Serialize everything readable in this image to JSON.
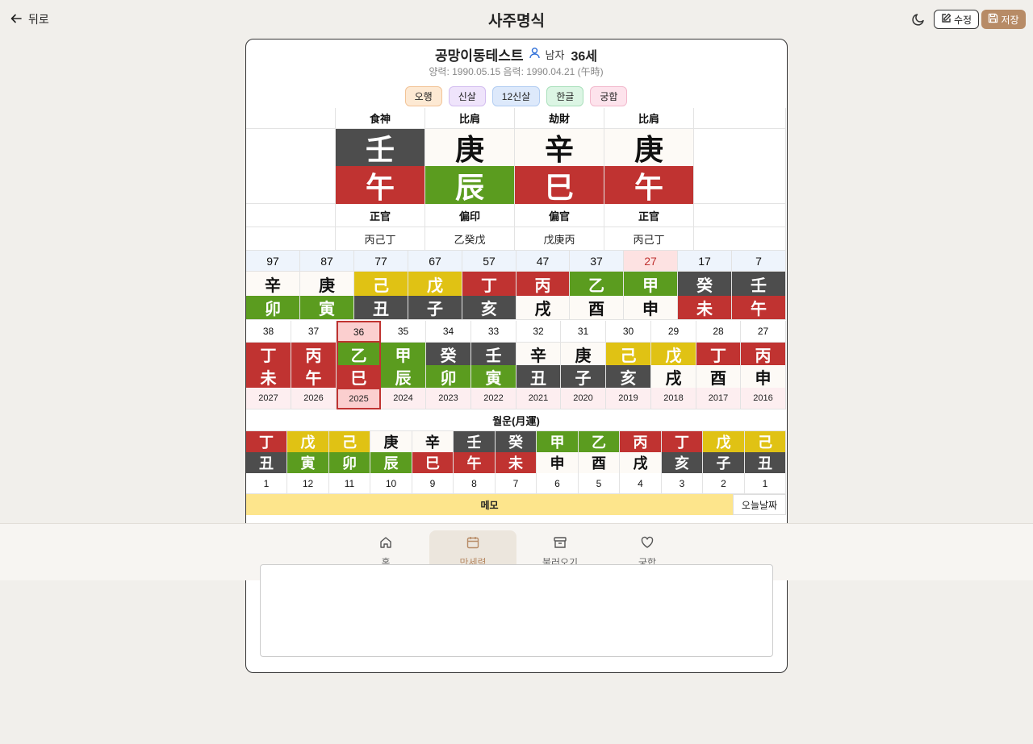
{
  "header": {
    "back_label": "뒤로",
    "title": "사주명식",
    "edit_label": "수정",
    "save_label": "저장"
  },
  "profile": {
    "name": "공망이동테스트",
    "gender": "남자",
    "age": "36세",
    "dates": "양력: 1990.05.15 음력: 1990.04.21 (午時)"
  },
  "chips": [
    {
      "label": "오행",
      "bg": "#fde9d3",
      "border": "#f2c396"
    },
    {
      "label": "신살",
      "bg": "#efe4fb",
      "border": "#d3bdf0"
    },
    {
      "label": "12신살",
      "bg": "#dde9fb",
      "border": "#b2cdf2"
    },
    {
      "label": "한글",
      "bg": "#dcf5e4",
      "border": "#a9e0bb"
    },
    {
      "label": "궁합",
      "bg": "#fde3ec",
      "border": "#f2b8cc"
    }
  ],
  "colors": {
    "fire": "#c03331",
    "wood": "#5b9c1f",
    "earth": "#e0c214",
    "water": "#4d4d4d",
    "metal": "#fdfaf6",
    "highlight": "#fbcfcf",
    "highlight_border": "#c03331",
    "memo": "#fde58c",
    "accent": "#b78b66"
  },
  "pillars": [
    {
      "top_god": "食神",
      "stem": "壬",
      "stem_el": "water",
      "branch": "午",
      "branch_el": "fire",
      "bot_god": "正官",
      "hidden": "丙己丁"
    },
    {
      "top_god": "比肩",
      "stem": "庚",
      "stem_el": "metal",
      "branch": "辰",
      "branch_el": "wood",
      "bot_god": "偏印",
      "hidden": "乙癸戊"
    },
    {
      "top_god": "劫財",
      "stem": "辛",
      "stem_el": "metal",
      "branch": "巳",
      "branch_el": "fire",
      "bot_god": "偏官",
      "hidden": "戊庚丙"
    },
    {
      "top_god": "比肩",
      "stem": "庚",
      "stem_el": "metal",
      "branch": "午",
      "branch_el": "fire",
      "bot_god": "正官",
      "hidden": "丙己丁"
    }
  ],
  "daewoon": [
    {
      "age": "97",
      "stem": "辛",
      "se": "metal",
      "branch": "卯",
      "be": "wood"
    },
    {
      "age": "87",
      "stem": "庚",
      "se": "metal",
      "branch": "寅",
      "be": "wood"
    },
    {
      "age": "77",
      "stem": "己",
      "se": "earth",
      "branch": "丑",
      "be": "water"
    },
    {
      "age": "67",
      "stem": "戊",
      "se": "earth",
      "branch": "子",
      "be": "water"
    },
    {
      "age": "57",
      "stem": "丁",
      "se": "fire",
      "branch": "亥",
      "be": "water"
    },
    {
      "age": "47",
      "stem": "丙",
      "se": "fire",
      "branch": "戌",
      "be": "metal"
    },
    {
      "age": "37",
      "stem": "乙",
      "se": "wood",
      "branch": "酉",
      "be": "metal"
    },
    {
      "age": "27",
      "stem": "甲",
      "se": "wood",
      "branch": "申",
      "be": "metal",
      "current": true
    },
    {
      "age": "17",
      "stem": "癸",
      "se": "water",
      "branch": "未",
      "be": "fire"
    },
    {
      "age": "7",
      "stem": "壬",
      "se": "water",
      "branch": "午",
      "be": "fire"
    }
  ],
  "sewoon": [
    {
      "age": "38",
      "stem": "丁",
      "se": "fire",
      "branch": "未",
      "be": "fire",
      "year": "2027"
    },
    {
      "age": "37",
      "stem": "丙",
      "se": "fire",
      "branch": "午",
      "be": "fire",
      "year": "2026"
    },
    {
      "age": "36",
      "stem": "乙",
      "se": "wood",
      "branch": "巳",
      "be": "fire",
      "year": "2025",
      "current": true
    },
    {
      "age": "35",
      "stem": "甲",
      "se": "wood",
      "branch": "辰",
      "be": "wood",
      "year": "2024"
    },
    {
      "age": "34",
      "stem": "癸",
      "se": "water",
      "branch": "卯",
      "be": "wood",
      "year": "2023"
    },
    {
      "age": "33",
      "stem": "壬",
      "se": "water",
      "branch": "寅",
      "be": "wood",
      "year": "2022"
    },
    {
      "age": "32",
      "stem": "辛",
      "se": "metal",
      "branch": "丑",
      "be": "water",
      "year": "2021"
    },
    {
      "age": "31",
      "stem": "庚",
      "se": "metal",
      "branch": "子",
      "be": "water",
      "year": "2020"
    },
    {
      "age": "30",
      "stem": "己",
      "se": "earth",
      "branch": "亥",
      "be": "water",
      "year": "2019"
    },
    {
      "age": "29",
      "stem": "戊",
      "se": "earth",
      "branch": "戌",
      "be": "metal",
      "year": "2018"
    },
    {
      "age": "28",
      "stem": "丁",
      "se": "fire",
      "branch": "酉",
      "be": "metal",
      "year": "2017"
    },
    {
      "age": "27",
      "stem": "丙",
      "se": "fire",
      "branch": "申",
      "be": "metal",
      "year": "2016"
    }
  ],
  "wolwoon": {
    "title": "월운(月運)",
    "items": [
      {
        "stem": "丁",
        "se": "fire",
        "branch": "丑",
        "be": "water",
        "month": "1"
      },
      {
        "stem": "戊",
        "se": "earth",
        "branch": "寅",
        "be": "wood",
        "month": "12"
      },
      {
        "stem": "己",
        "se": "earth",
        "branch": "卯",
        "be": "wood",
        "month": "11"
      },
      {
        "stem": "庚",
        "se": "metal",
        "branch": "辰",
        "be": "wood",
        "month": "10"
      },
      {
        "stem": "辛",
        "se": "metal",
        "branch": "巳",
        "be": "fire",
        "month": "9"
      },
      {
        "stem": "壬",
        "se": "water",
        "branch": "午",
        "be": "fire",
        "month": "8"
      },
      {
        "stem": "癸",
        "se": "water",
        "branch": "未",
        "be": "fire",
        "month": "7"
      },
      {
        "stem": "甲",
        "se": "wood",
        "branch": "申",
        "be": "metal",
        "month": "6"
      },
      {
        "stem": "乙",
        "se": "wood",
        "branch": "酉",
        "be": "metal",
        "month": "5"
      },
      {
        "stem": "丙",
        "se": "fire",
        "branch": "戌",
        "be": "metal",
        "month": "4"
      },
      {
        "stem": "丁",
        "se": "fire",
        "branch": "亥",
        "be": "water",
        "month": "3"
      },
      {
        "stem": "戊",
        "se": "earth",
        "branch": "子",
        "be": "water",
        "month": "2"
      },
      {
        "stem": "己",
        "se": "earth",
        "branch": "丑",
        "be": "water",
        "month": "1"
      }
    ]
  },
  "memo": {
    "label": "메모",
    "today_label": "오늘날짜",
    "text": ""
  },
  "nav": [
    {
      "label": "홈",
      "icon": "home-icon"
    },
    {
      "label": "만세력",
      "icon": "calendar-icon",
      "active": true
    },
    {
      "label": "불러오기",
      "icon": "archive-icon"
    },
    {
      "label": "궁합",
      "icon": "heart-icon"
    }
  ]
}
